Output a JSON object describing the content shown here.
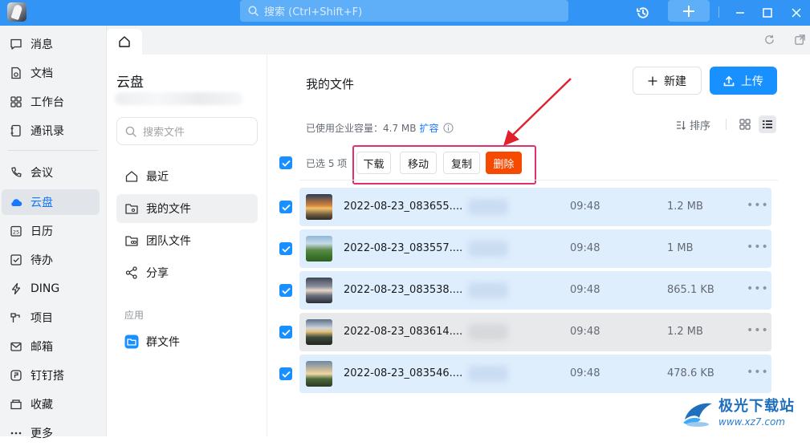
{
  "titlebar": {
    "search_placeholder": "搜索 (Ctrl+Shift+F)",
    "accent": "#3295f5"
  },
  "nav": {
    "items": [
      {
        "label": "消息",
        "icon": "message-icon"
      },
      {
        "label": "文档",
        "icon": "document-icon"
      },
      {
        "label": "工作台",
        "icon": "workbench-icon"
      },
      {
        "label": "通讯录",
        "icon": "contacts-icon"
      },
      {
        "label": "会议",
        "icon": "meeting-icon"
      },
      {
        "label": "云盘",
        "icon": "cloud-icon",
        "active": true
      },
      {
        "label": "日历",
        "icon": "calendar-icon",
        "badge": "25"
      },
      {
        "label": "待办",
        "icon": "todo-icon"
      },
      {
        "label": "DING",
        "icon": "ding-icon"
      },
      {
        "label": "项目",
        "icon": "project-icon"
      },
      {
        "label": "邮箱",
        "icon": "mail-icon"
      },
      {
        "label": "钉钉搭",
        "icon": "builder-icon"
      },
      {
        "label": "收藏",
        "icon": "favorite-icon"
      },
      {
        "label": "更多",
        "icon": "more-icon"
      }
    ]
  },
  "cloud": {
    "title": "云盘",
    "search_placeholder": "搜索文件",
    "menu": [
      {
        "label": "最近",
        "icon": "recent-icon"
      },
      {
        "label": "我的文件",
        "icon": "my-files-icon",
        "active": true
      },
      {
        "label": "团队文件",
        "icon": "team-files-icon"
      },
      {
        "label": "分享",
        "icon": "share-icon"
      }
    ],
    "apps_label": "应用",
    "apps": [
      {
        "label": "群文件",
        "icon": "group-file-icon"
      }
    ]
  },
  "main": {
    "title": "我的文件",
    "new_label": "新建",
    "upload_label": "上传",
    "quota_text": "已使用企业容量：4.7 MB",
    "expand_label": "扩容",
    "sort_label": "排序",
    "selected_text": "已选 5 项",
    "actions": {
      "download": "下载",
      "move": "移动",
      "copy": "复制",
      "delete": "删除"
    },
    "delete_color": "#f54a00",
    "highlight_color": "#e0306d",
    "files": [
      {
        "name": "2022-08-23_083655....",
        "time": "09:48",
        "size": "1.2 MB",
        "checked": true
      },
      {
        "name": "2022-08-23_083557....",
        "time": "09:48",
        "size": "1 MB",
        "checked": true
      },
      {
        "name": "2022-08-23_083538....",
        "time": "09:48",
        "size": "865.1 KB",
        "checked": true
      },
      {
        "name": "2022-08-23_083614....",
        "time": "09:48",
        "size": "1.2 MB",
        "checked": true
      },
      {
        "name": "2022-08-23_083546....",
        "time": "09:48",
        "size": "478.6 KB",
        "checked": true
      }
    ]
  },
  "watermark": {
    "title": "极光下载站",
    "url": "www.xz7.com"
  }
}
